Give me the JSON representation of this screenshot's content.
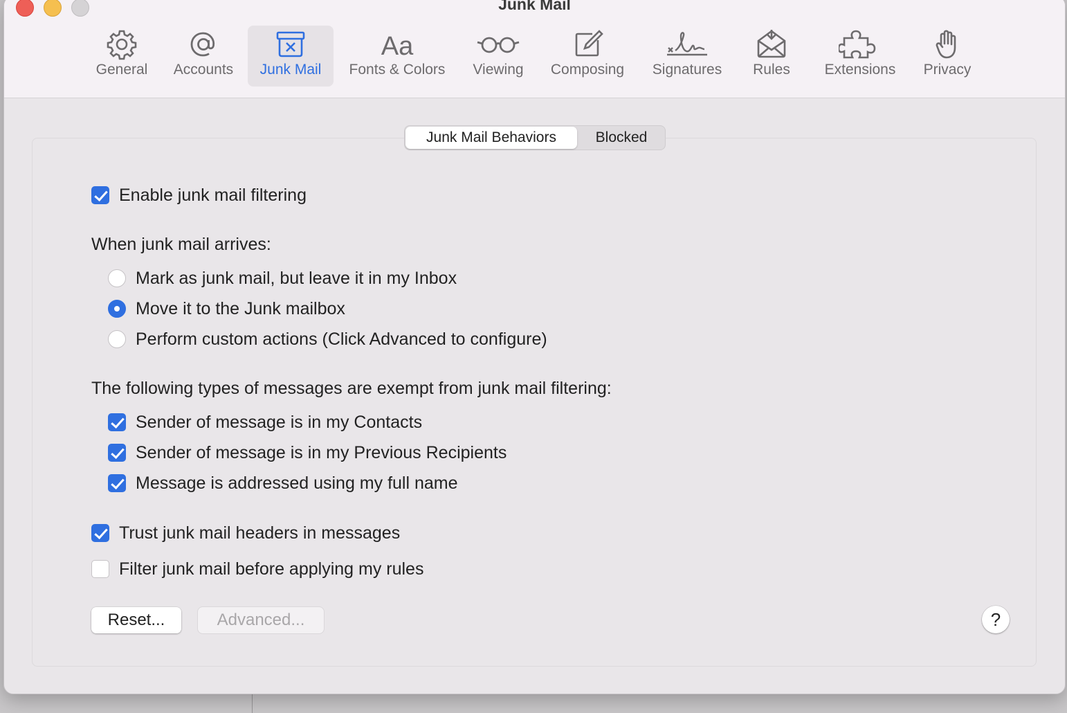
{
  "window": {
    "title": "Junk Mail"
  },
  "toolbar": {
    "items": [
      {
        "label": "General",
        "icon": "gear-icon"
      },
      {
        "label": "Accounts",
        "icon": "at-sign-icon"
      },
      {
        "label": "Junk Mail",
        "icon": "junk-box-icon",
        "active": true
      },
      {
        "label": "Fonts & Colors",
        "icon": "font-aa-icon"
      },
      {
        "label": "Viewing",
        "icon": "glasses-icon"
      },
      {
        "label": "Composing",
        "icon": "compose-icon"
      },
      {
        "label": "Signatures",
        "icon": "signature-icon"
      },
      {
        "label": "Rules",
        "icon": "envelope-rules-icon"
      },
      {
        "label": "Extensions",
        "icon": "puzzle-icon"
      },
      {
        "label": "Privacy",
        "icon": "hand-icon"
      }
    ],
    "accent_color": "#2f6fe0"
  },
  "tabs": {
    "behaviors": "Junk Mail Behaviors",
    "blocked": "Blocked",
    "selected": "Junk Mail Behaviors"
  },
  "settings": {
    "enable_filtering": {
      "label": "Enable junk mail filtering",
      "checked": true
    },
    "arrival_heading": "When junk mail arrives:",
    "arrival_options": [
      {
        "label": "Mark as junk mail, but leave it in my Inbox",
        "selected": false
      },
      {
        "label": "Move it to the Junk mailbox",
        "selected": true
      },
      {
        "label": "Perform custom actions (Click Advanced to configure)",
        "selected": false
      }
    ],
    "exempt_heading": "The following types of messages are exempt from junk mail filtering:",
    "exempt_options": [
      {
        "label": "Sender of message is in my Contacts",
        "checked": true
      },
      {
        "label": "Sender of message is in my Previous Recipients",
        "checked": true
      },
      {
        "label": "Message is addressed using my full name",
        "checked": true
      }
    ],
    "trust_headers": {
      "label": "Trust junk mail headers in messages",
      "checked": true
    },
    "filter_before_rules": {
      "label": "Filter junk mail before applying my rules",
      "checked": false
    }
  },
  "buttons": {
    "reset": "Reset...",
    "advanced": "Advanced...",
    "help": "?"
  }
}
